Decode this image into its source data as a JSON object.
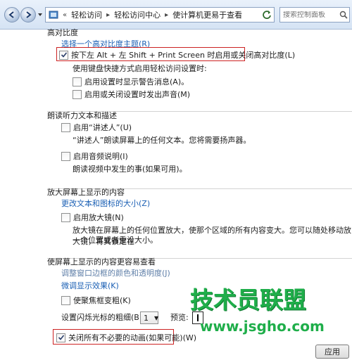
{
  "address_bar": {
    "breadcrumbs": [
      "轻松访问",
      "轻松访问中心",
      "使计算机更易于查看"
    ],
    "search_placeholder": "搜索控制面板"
  },
  "high_contrast": {
    "title": "高对比度",
    "theme_link": "选择一个高对比度主题(R)",
    "shortcut_checkbox": {
      "label": "按下左 Alt + 左 Shift + Print Screen 时启用或关闭高对比度(L)",
      "checked": true
    },
    "shortcut_desc": "使用键盘快捷方式启用轻松访问设置时:",
    "warning_checkbox": {
      "label": "启用设置时显示警告消息(A)。",
      "checked": false
    },
    "sound_checkbox": {
      "label": "启用或关闭设置时发出声音(M)",
      "checked": false
    }
  },
  "narrator": {
    "title": "朗读听力文本和描述",
    "narrator_checkbox": {
      "label": "启用“讲述人”(U)",
      "checked": false
    },
    "narrator_desc": "“讲述人”朗读屏幕上的任何文本。您将需要扬声器。",
    "audio_desc_checkbox": {
      "label": "启用音频说明(I)",
      "checked": false
    },
    "audio_desc_desc": "朗读视频中发生的事(如果可用)。"
  },
  "magnify": {
    "title": "放大屏幕上显示的内容",
    "size_link": "更改文本和图标的大小(Z)",
    "magnifier_checkbox": {
      "label": "启用放大镜(N)",
      "checked": false
    },
    "magnifier_desc_1": "放大镜在屏幕上的任何位置放大，使那个区域的所有内容变大。您可以随处移动放大镜，将其锁定在",
    "magnifier_desc_2": "一个位置或者重设大小。"
  },
  "easier_view": {
    "title": "使屏幕上显示的内容更容易查看",
    "border_link": "调整窗口边框的颜色和透明度(J)",
    "effects_link": "微调显示效果(K)",
    "focus_checkbox": {
      "label": "使聚焦框变粗(K)",
      "checked": false
    },
    "cursor_label": "设置闪烁光标的粗细(B):",
    "cursor_value": "1",
    "preview_label": "预览:",
    "animations_checkbox": {
      "label": "关闭所有不必要的动画(如果可能)(W)",
      "checked": true
    }
  },
  "footer": {
    "apply_button": "应用"
  },
  "watermark": {
    "title": "技术员联盟",
    "url": "www.jsgho.com"
  },
  "colors": {
    "link": "#1a5fb4",
    "highlight": "#cc2222",
    "watermark": "#1fae4a"
  }
}
